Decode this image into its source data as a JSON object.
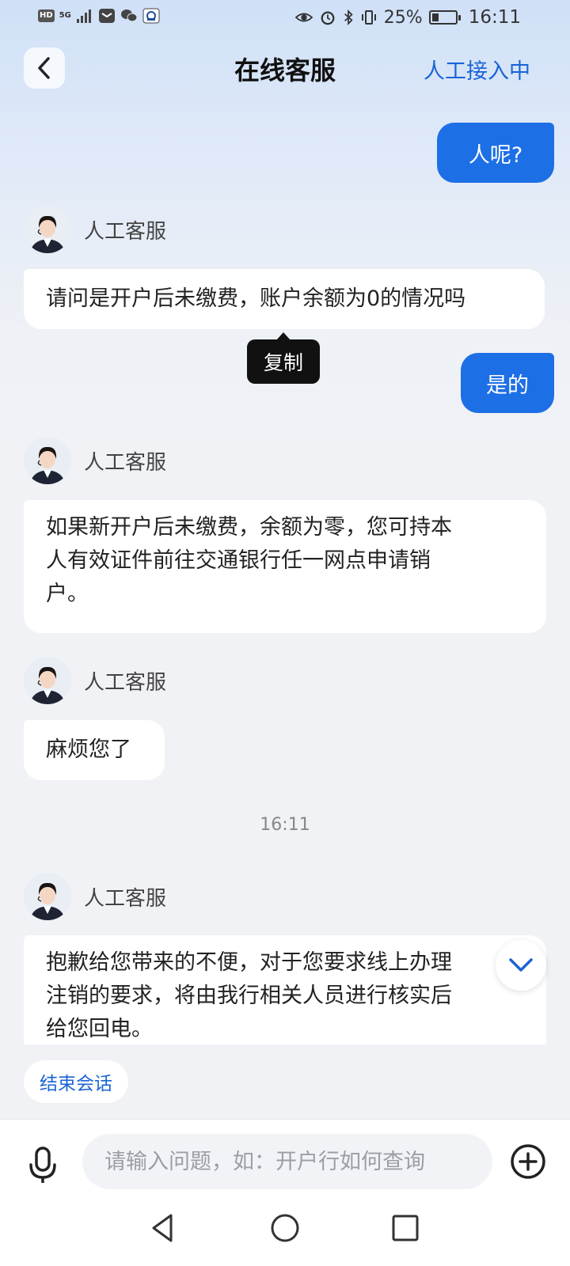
{
  "status_bar": {
    "left_badges": [
      "HD",
      "5G"
    ],
    "battery": "25%",
    "time": "16:11"
  },
  "header": {
    "title": "在线客服",
    "status": "人工接入中",
    "back_icon": "chevron-left-icon"
  },
  "messages": {
    "user_1": "人呢?",
    "agent_1": {
      "name": "人工客服",
      "text": "请问是开户后未缴费，账户余额为0的情况吗"
    },
    "tooltip": "复制",
    "user_2": "是的",
    "agent_2": {
      "name": "人工客服",
      "lines": [
        "如果新开户后未缴费，余额为零，您可持本",
        "人有效证件前往交通银行任一网点申请销",
        "户。"
      ]
    },
    "agent_3": {
      "name": "人工客服",
      "text": "麻烦您了"
    },
    "timestamp": "16:11",
    "agent_4": {
      "name": "人工客服",
      "lines": [
        "抱歉给您带来的不便，对于您要求线上办理",
        "注销的要求，将由我行相关人员进行核实后",
        "给您回电。"
      ]
    }
  },
  "actions": {
    "end_chat": "结束会话"
  },
  "input": {
    "placeholder": "请输入问题，如：开户行如何查询"
  },
  "colors": {
    "accent": "#1d6fe6",
    "link": "#1a64d6"
  }
}
